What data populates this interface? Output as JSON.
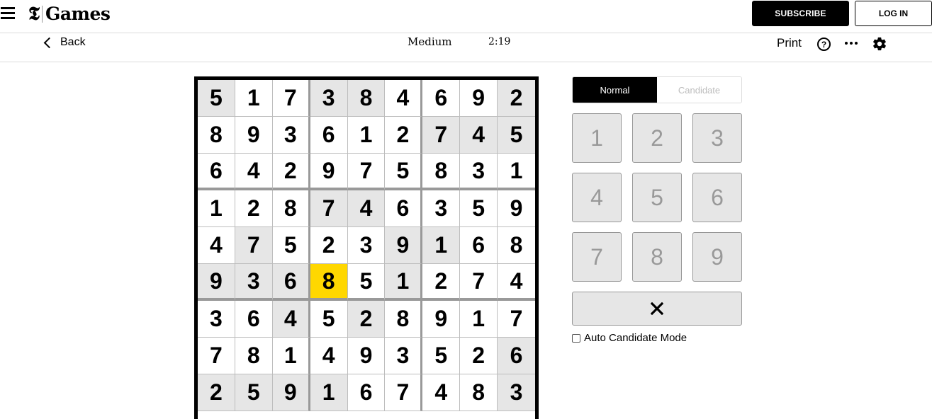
{
  "header": {
    "logo_mark": "𝕿",
    "logo_text": "Games",
    "subscribe_label": "SUBSCRIBE",
    "login_label": "LOG IN"
  },
  "toolbar": {
    "back_label": "Back",
    "difficulty": "Medium",
    "timer": "2:19",
    "print_label": "Print",
    "help_glyph": "?"
  },
  "board": {
    "rows": [
      [
        5,
        1,
        7,
        3,
        8,
        4,
        6,
        9,
        2
      ],
      [
        8,
        9,
        3,
        6,
        1,
        2,
        7,
        4,
        5
      ],
      [
        6,
        4,
        2,
        9,
        7,
        5,
        8,
        3,
        1
      ],
      [
        1,
        2,
        8,
        7,
        4,
        6,
        3,
        5,
        9
      ],
      [
        4,
        7,
        5,
        2,
        3,
        9,
        1,
        6,
        8
      ],
      [
        9,
        3,
        6,
        8,
        5,
        1,
        2,
        7,
        4
      ],
      [
        3,
        6,
        4,
        5,
        2,
        8,
        9,
        1,
        7
      ],
      [
        7,
        8,
        1,
        4,
        9,
        3,
        5,
        2,
        6
      ],
      [
        2,
        5,
        9,
        1,
        6,
        7,
        4,
        8,
        3
      ]
    ],
    "shaded": [
      [
        0,
        0
      ],
      [
        0,
        3
      ],
      [
        0,
        4
      ],
      [
        0,
        8
      ],
      [
        1,
        6
      ],
      [
        1,
        7
      ],
      [
        1,
        8
      ],
      [
        3,
        3
      ],
      [
        3,
        4
      ],
      [
        4,
        1
      ],
      [
        4,
        5
      ],
      [
        4,
        6
      ],
      [
        5,
        0
      ],
      [
        5,
        1
      ],
      [
        5,
        2
      ],
      [
        5,
        5
      ],
      [
        6,
        2
      ],
      [
        6,
        4
      ],
      [
        7,
        8
      ],
      [
        8,
        0
      ],
      [
        8,
        1
      ],
      [
        8,
        2
      ],
      [
        8,
        3
      ],
      [
        8,
        8
      ]
    ],
    "selected": [
      5,
      3
    ],
    "colors": {
      "selected": "#ffd700",
      "shaded": "#e6e6e6"
    }
  },
  "panel": {
    "modes": {
      "normal": "Normal",
      "candidate": "Candidate",
      "active": "normal"
    },
    "keys": [
      "1",
      "2",
      "3",
      "4",
      "5",
      "6",
      "7",
      "8",
      "9"
    ],
    "delete_glyph": "✕",
    "auto_candidate_label": "Auto Candidate Mode",
    "auto_candidate_checked": false
  }
}
